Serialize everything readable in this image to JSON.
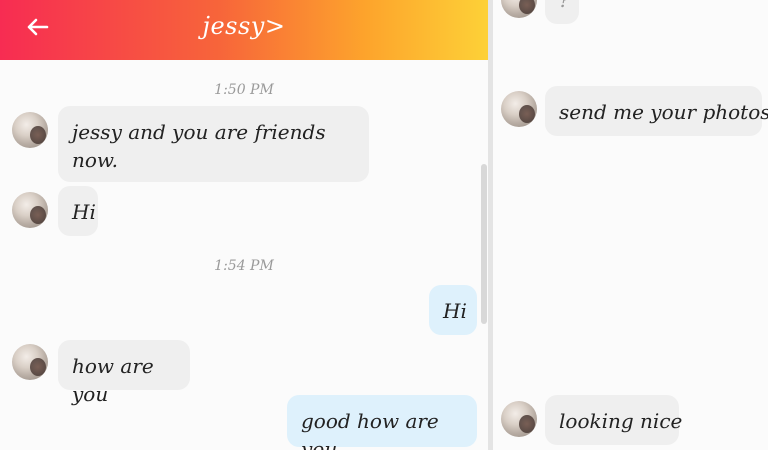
{
  "header": {
    "title": "jessy>"
  },
  "left": {
    "timestamps": [
      "1:50 PM",
      "1:54 PM"
    ],
    "messages": [
      {
        "text": "jessy and you are friends now."
      },
      {
        "text": "Hi"
      },
      {
        "text": "Hi"
      },
      {
        "text": "how are you"
      },
      {
        "text": "good how are you"
      }
    ]
  },
  "right": {
    "messages": [
      {
        "text": "?"
      },
      {
        "text": "send me your photos"
      },
      {
        "text": "looking nice"
      }
    ]
  },
  "icons": {
    "back": "arrow-left-icon"
  },
  "colors": {
    "header_gradient": [
      "#f72c52",
      "#fdd137"
    ],
    "incoming_bubble": "#efefef",
    "outgoing_bubble": "#def1fc"
  }
}
